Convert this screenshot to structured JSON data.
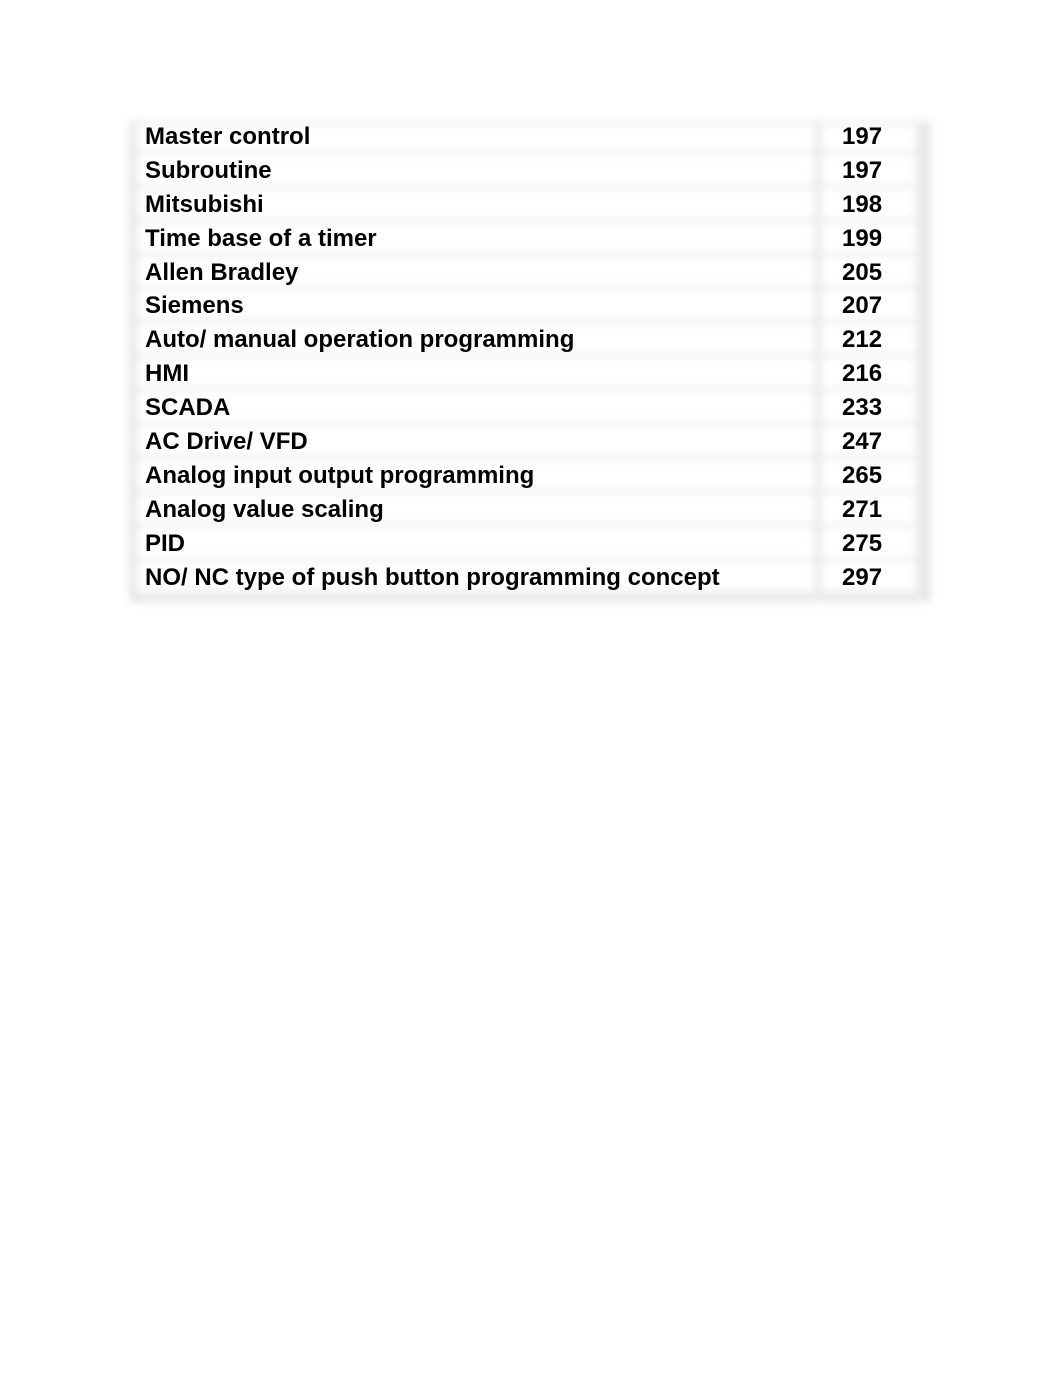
{
  "toc": {
    "entries": [
      {
        "topic": "Master control",
        "page": "197"
      },
      {
        "topic": "Subroutine",
        "page": "197"
      },
      {
        "topic": "Mitsubishi",
        "page": "198"
      },
      {
        "topic": "Time base of a timer",
        "page": "199"
      },
      {
        "topic": "Allen Bradley",
        "page": "205"
      },
      {
        "topic": "Siemens",
        "page": "207"
      },
      {
        "topic": "Auto/ manual operation programming",
        "page": "212"
      },
      {
        "topic": "HMI",
        "page": "216"
      },
      {
        "topic": "SCADA",
        "page": "233"
      },
      {
        "topic": "AC Drive/ VFD",
        "page": "247"
      },
      {
        "topic": "Analog input output programming",
        "page": "265"
      },
      {
        "topic": "Analog value scaling",
        "page": "271"
      },
      {
        "topic": "PID",
        "page": "275"
      },
      {
        "topic": "NO/ NC type of push button programming concept",
        "page": "297"
      }
    ]
  }
}
